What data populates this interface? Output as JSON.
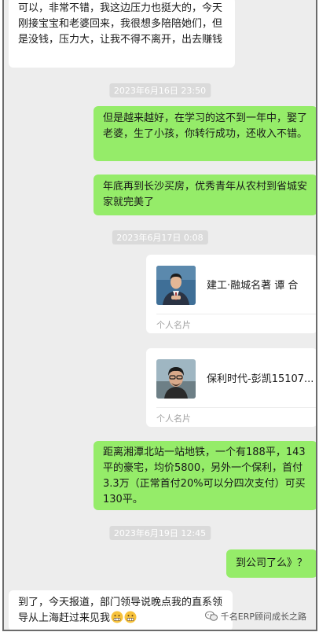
{
  "chat": {
    "msg1": "可以，非常不错，我这边压力也挺大的，今天刚接宝宝和老婆回来，我很想多陪陪她们，但是没钱，压力大，让我不得不离开，出去赚钱",
    "time1": "2023年6月16日 23:50",
    "msg2": "但是越来越好，在学习的这不到一年中，娶了老婆，生了小孩，你转行成功，还收入不错。",
    "msg3": "年底再到长沙买房，优秀青年从农村到省城安家就完美了",
    "time2": "2023年6月17日 0:08",
    "card1_name": "建工·融城名著 谭 合",
    "card1_type": "个人名片",
    "card2_name": "保利时代-彭凯15107...",
    "card2_type": "个人名片",
    "msg4": "距离湘潭北站一站地铁，一个有188平，143平的豪宅，均价5800，另外一个保利，首付3.3万（正常首付20%可以分四次支付）可买130平。",
    "time3": "2023年6月19日 12:45",
    "msg5": "到公司了么》？",
    "msg6": "到了，今天报道，部门领导说晚点我的直系领导从上海赶过来见我"
  },
  "watermark": {
    "text": "千名ERP顾问成长之路"
  },
  "icons": {
    "emoji": "grimace-emoji-icon",
    "wechat": "wechat-logo-icon"
  },
  "colors": {
    "right_bubble": "#95ec69",
    "left_bubble": "#ffffff",
    "background": "#ededed"
  }
}
